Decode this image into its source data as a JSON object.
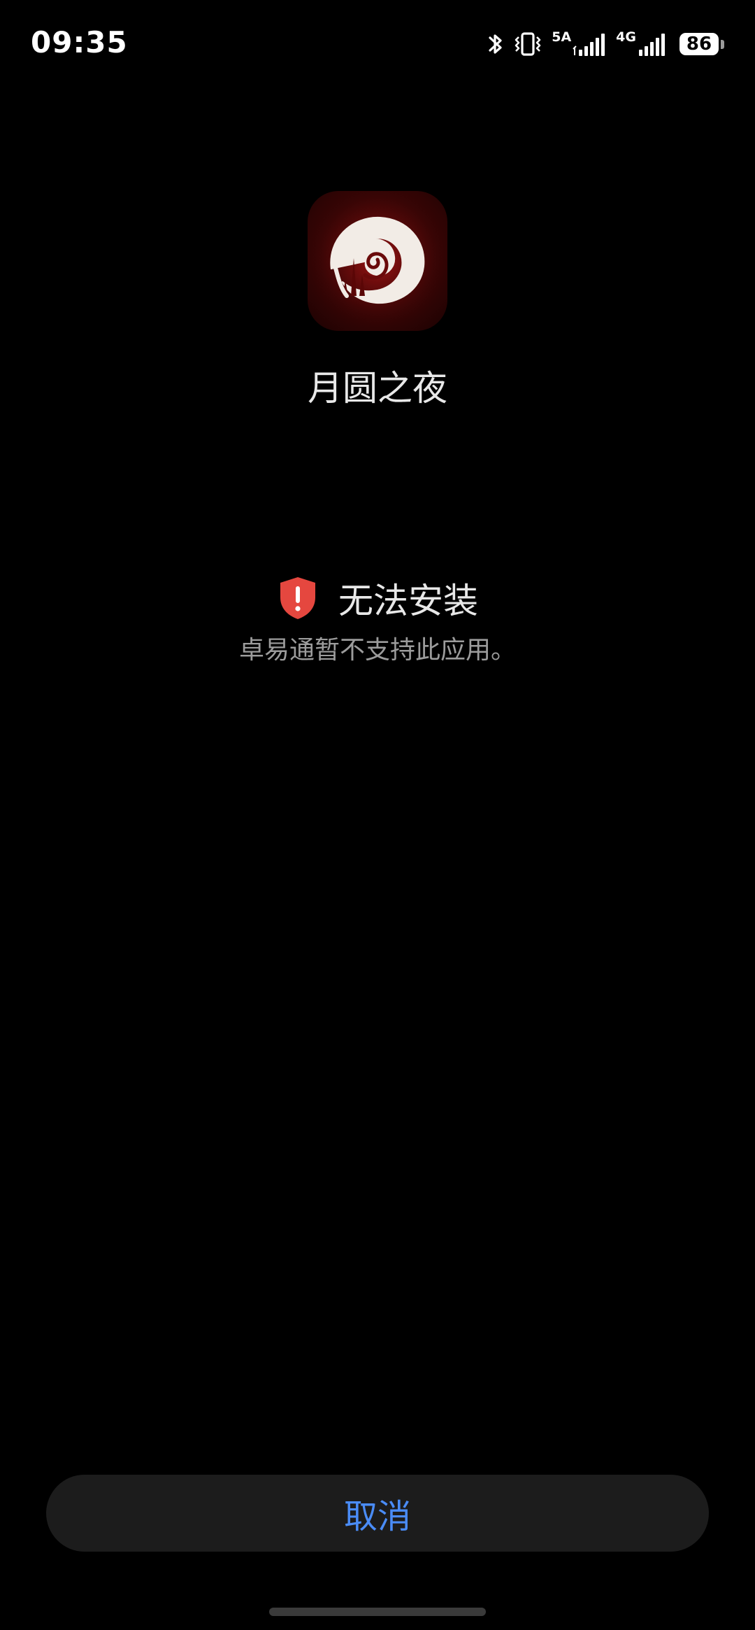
{
  "status_bar": {
    "time": "09:35",
    "sim1_label": "5A",
    "sim2_label": "4G",
    "battery_level": "86",
    "icons": [
      "bluetooth-icon",
      "vibrate-icon",
      "signal-icon",
      "signal-icon",
      "battery-icon"
    ]
  },
  "app": {
    "name": "月圆之夜",
    "icon": "app-icon"
  },
  "error": {
    "icon": "shield-alert-icon",
    "title": "无法安装",
    "description": "卓易通暂不支持此应用。",
    "color": "#E5473F"
  },
  "actions": {
    "cancel_label": "取消",
    "accent_color": "#4A8CF7"
  },
  "theme": {
    "background": "#000000"
  }
}
